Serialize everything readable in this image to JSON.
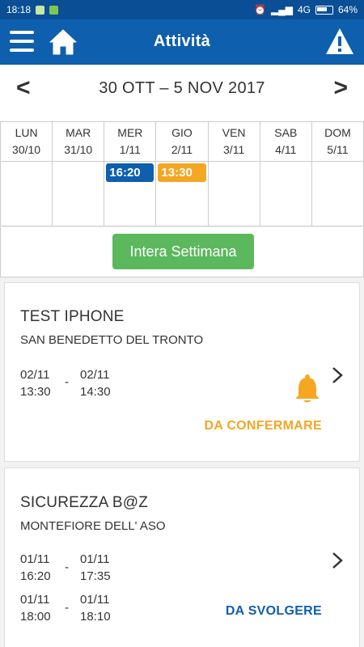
{
  "statusbar": {
    "time": "18:18",
    "network": "4G",
    "battery": "64%"
  },
  "appbar": {
    "title": "Attività"
  },
  "week": {
    "prev_label": "<",
    "next_label": ">",
    "title": "30 OTT – 5 NOV 2017"
  },
  "calendar": {
    "days": [
      {
        "name": "LUN",
        "date": "30/10"
      },
      {
        "name": "MAR",
        "date": "31/10"
      },
      {
        "name": "MER",
        "date": "1/11",
        "event": "16:20",
        "event_color": "#0e5fae"
      },
      {
        "name": "GIO",
        "date": "2/11",
        "event": "13:30",
        "event_color": "#f5a623"
      },
      {
        "name": "VEN",
        "date": "3/11"
      },
      {
        "name": "SAB",
        "date": "4/11"
      },
      {
        "name": "DOM",
        "date": "5/11"
      }
    ]
  },
  "week_button": {
    "label": "Intera Settimana"
  },
  "cards": [
    {
      "title": "TEST IPHONE",
      "place": "SAN BENEDETTO DEL TRONTO",
      "slots": [
        {
          "start_date": "02/11",
          "start_time": "13:30",
          "end_date": "02/11",
          "end_time": "14:30"
        }
      ],
      "status": "DA CONFERMARE",
      "status_color": "#f5a623",
      "icon": "bell-icon"
    },
    {
      "title": "SICUREZZA B@Z",
      "place": "MONTEFIORE DELL' ASO",
      "slots": [
        {
          "start_date": "01/11",
          "start_time": "16:20",
          "end_date": "01/11",
          "end_time": "17:35"
        },
        {
          "start_date": "01/11",
          "start_time": "18:00",
          "end_date": "01/11",
          "end_time": "18:10"
        }
      ],
      "status": "DA SVOLGERE",
      "status_color": "#0e5fae"
    }
  ],
  "colors": {
    "primary": "#0e5fae",
    "success": "#5cb85c",
    "warning": "#f5a623"
  }
}
